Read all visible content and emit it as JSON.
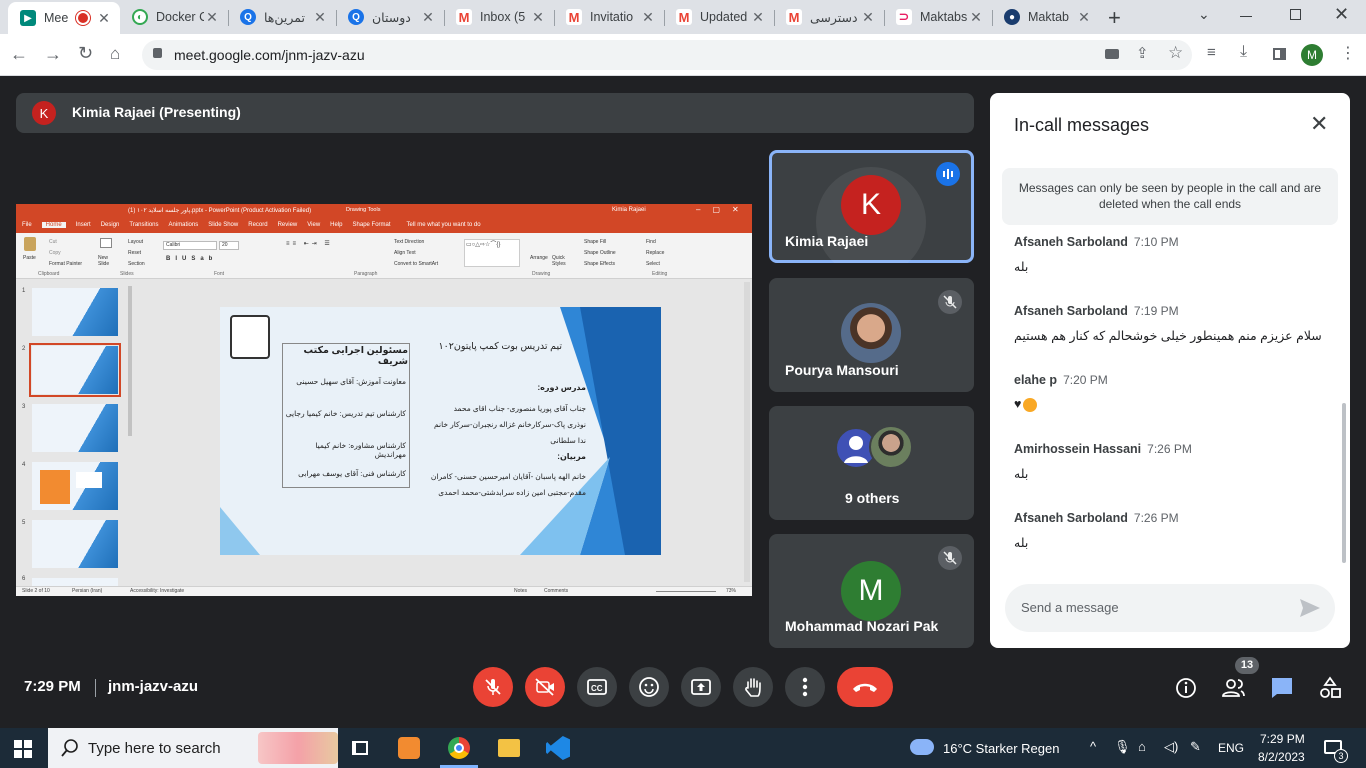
{
  "browser": {
    "tabs": [
      {
        "title": "Mee",
        "active": true
      },
      {
        "title": "Docker C"
      },
      {
        "title": "تمرین‌ها"
      },
      {
        "title": "دوستان"
      },
      {
        "title": "Inbox (5"
      },
      {
        "title": "Invitatio"
      },
      {
        "title": "Updated"
      },
      {
        "title": "دسترسی"
      },
      {
        "title": "Maktabs"
      },
      {
        "title": "Maktab"
      }
    ],
    "url": "meet.google.com/jnm-jazv-azu",
    "profile_initial": "M"
  },
  "presenter": {
    "initial": "K",
    "label": "Kimia Rajaei (Presenting)"
  },
  "slide": {
    "window_title": "پاور جلسه اسلاید ۱۰۲ (1).pptx - PowerPoint (Product Activation Failed)",
    "drawing_tools": "Drawing Tools",
    "user": "Kimia Rajaei",
    "tabs": [
      "File",
      "Home",
      "Insert",
      "Design",
      "Transitions",
      "Animations",
      "Slide Show",
      "Record",
      "Review",
      "View",
      "Help",
      "Shape Format"
    ],
    "tellme": "Tell me what you want to do",
    "groups": [
      "Clipboard",
      "Slides",
      "Font",
      "Paragraph",
      "Drawing",
      "Editing"
    ],
    "font_name": "Calibri",
    "font_size": "20",
    "ribbon_labels": {
      "paste": "Paste",
      "cut": "Cut",
      "copy": "Copy",
      "format_painter": "Format Painter",
      "new_slide": "New Slide",
      "layout": "Layout",
      "reset": "Reset",
      "section": "Section",
      "text_direction": "Text Direction",
      "align_text": "Align Text",
      "convert_smartart": "Convert to SmartArt",
      "arrange": "Arrange",
      "quick_styles": "Quick Styles",
      "shape_fill": "Shape Fill",
      "shape_outline": "Shape Outline",
      "shape_effects": "Shape Effects",
      "find": "Find",
      "replace": "Replace",
      "select": "Select"
    },
    "title_right": "تیم تدریس بوت کمپ پایتون۱۰۲",
    "title_left": "مسئولین اجرایی مکتب شریف",
    "left_lines": [
      "معاونت آموزش: آقای سهیل حسینی",
      "کارشناس تیم تدریس: خانم کیمیا رجایی",
      "کارشناس مشاوره: خانم کیمیا مهراندیش",
      "کارشناس فنی: آقای یوسف مهرابی"
    ],
    "teacher_head": "مدرس دوره:",
    "teacher_lines": [
      "جناب آقای پوریا منصوری- جناب اقای محمد",
      "نوذری پاک-سرکارخانم غزاله رنجبران-سرکار خانم",
      "ندا سلطانی"
    ],
    "mentors_head": "مربیان:",
    "mentor_lines": [
      "خانم الهه پاسبان -آقایان امیرحسین حسنی- کامران",
      "مقدم-مجتبی امین زاده سرابدشتی-محمد احمدی"
    ],
    "status_slide": "Slide 2 of 10",
    "status_lang": "Persian (Iran)",
    "status_access": "Accessibility: Investigate",
    "status_notes": "Notes",
    "status_comments": "Comments",
    "status_zoom": "73%",
    "thumb_numbers": [
      "1",
      "2",
      "3",
      "4",
      "5",
      "6"
    ]
  },
  "participants": [
    {
      "name": "Kimia Rajaei",
      "initial": "K",
      "speaking": true
    },
    {
      "name": "Pourya Mansouri",
      "muted": true
    },
    {
      "name": "9 others"
    },
    {
      "name": "Mohammad Nozari Pak",
      "initial": "M",
      "muted": true
    }
  ],
  "chat": {
    "title": "In-call messages",
    "note": "Messages can only be seen by people in the call and are deleted when the call ends",
    "messages": [
      {
        "sender": "Afsaneh Sarboland",
        "time": "7:10 PM",
        "text": "بله"
      },
      {
        "sender": "Afsaneh Sarboland",
        "time": "7:19 PM",
        "text": "سلام عزیزم منم همینطور خیلی خوشحالم که کنار هم هستیم"
      },
      {
        "sender": "elahe p",
        "time": "7:20 PM",
        "text": "♥"
      },
      {
        "sender": "Amirhossein Hassani",
        "time": "7:26 PM",
        "text": "بله"
      },
      {
        "sender": "Afsaneh Sarboland",
        "time": "7:26 PM",
        "text": "بله"
      }
    ],
    "placeholder": "Send a message"
  },
  "controls": {
    "time": "7:29 PM",
    "meeting_code": "jnm-jazv-azu",
    "people_count": "13"
  },
  "taskbar": {
    "search_placeholder": "Type here to search",
    "weather": "16°C  Starker Regen",
    "lang": "ENG",
    "time": "7:29 PM",
    "date": "8/2/2023",
    "notifications": "3"
  },
  "colors": {
    "meet_bg": "#202124",
    "tile_bg": "#3c4043",
    "red": "#ea4335",
    "ppt_orange": "#d24726",
    "active_border": "#8ab4f8"
  }
}
